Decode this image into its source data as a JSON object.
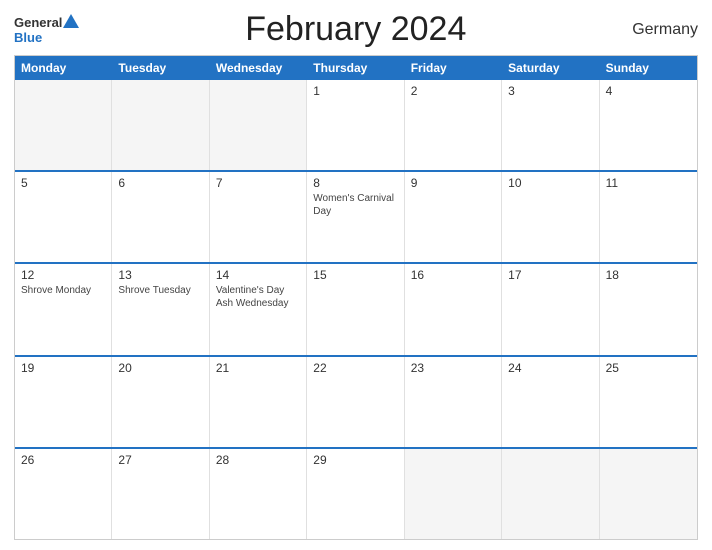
{
  "header": {
    "logo_general": "General",
    "logo_blue": "Blue",
    "title": "February 2024",
    "country": "Germany"
  },
  "days_of_week": [
    "Monday",
    "Tuesday",
    "Wednesday",
    "Thursday",
    "Friday",
    "Saturday",
    "Sunday"
  ],
  "weeks": [
    [
      {
        "day": "",
        "empty": true
      },
      {
        "day": "",
        "empty": true
      },
      {
        "day": "",
        "empty": true
      },
      {
        "day": "1",
        "events": []
      },
      {
        "day": "2",
        "events": []
      },
      {
        "day": "3",
        "events": []
      },
      {
        "day": "4",
        "events": []
      }
    ],
    [
      {
        "day": "5",
        "events": []
      },
      {
        "day": "6",
        "events": []
      },
      {
        "day": "7",
        "events": []
      },
      {
        "day": "8",
        "events": [
          "Women's Carnival Day"
        ]
      },
      {
        "day": "9",
        "events": []
      },
      {
        "day": "10",
        "events": []
      },
      {
        "day": "11",
        "events": []
      }
    ],
    [
      {
        "day": "12",
        "events": [
          "Shrove Monday"
        ]
      },
      {
        "day": "13",
        "events": [
          "Shrove Tuesday"
        ]
      },
      {
        "day": "14",
        "events": [
          "Valentine's Day",
          "Ash Wednesday"
        ]
      },
      {
        "day": "15",
        "events": []
      },
      {
        "day": "16",
        "events": []
      },
      {
        "day": "17",
        "events": []
      },
      {
        "day": "18",
        "events": []
      }
    ],
    [
      {
        "day": "19",
        "events": []
      },
      {
        "day": "20",
        "events": []
      },
      {
        "day": "21",
        "events": []
      },
      {
        "day": "22",
        "events": []
      },
      {
        "day": "23",
        "events": []
      },
      {
        "day": "24",
        "events": []
      },
      {
        "day": "25",
        "events": []
      }
    ],
    [
      {
        "day": "26",
        "events": []
      },
      {
        "day": "27",
        "events": []
      },
      {
        "day": "28",
        "events": []
      },
      {
        "day": "29",
        "events": []
      },
      {
        "day": "",
        "empty": true
      },
      {
        "day": "",
        "empty": true
      },
      {
        "day": "",
        "empty": true
      }
    ]
  ]
}
